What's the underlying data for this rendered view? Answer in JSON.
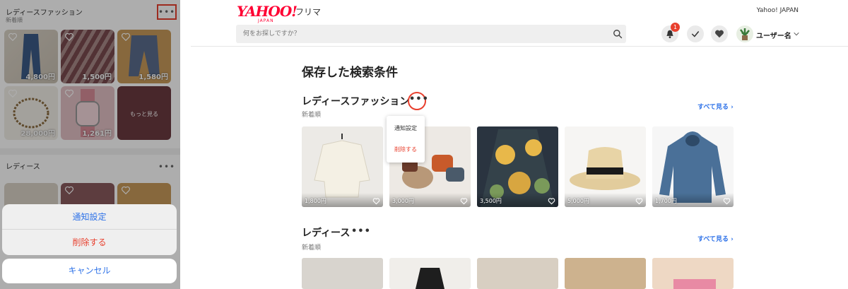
{
  "mobile": {
    "section1": {
      "title": "レディースファッション",
      "sort": "新着順",
      "more": "•••"
    },
    "items": [
      {
        "price": "4,800円"
      },
      {
        "price": "1,500円"
      },
      {
        "price": "1,580円"
      },
      {
        "price": "28,000円"
      },
      {
        "price": "1,261円"
      },
      {
        "price": "",
        "more_label": "もっと見る"
      }
    ],
    "section2": {
      "title": "レディース",
      "more": "•••"
    },
    "sheet": {
      "notify": "通知設定",
      "delete": "削除する",
      "cancel": "キャンセル"
    }
  },
  "header": {
    "logo": "YAHOO!",
    "logo_sub": "JAPAN",
    "app_name": "フリマ",
    "yj_link": "Yahoo! JAPAN",
    "search_placeholder": "何をお探しですか？",
    "notification_count": "1",
    "username": "ユーザー名"
  },
  "page": {
    "title": "保存した検索条件",
    "sections": [
      {
        "title": "レディースファッション",
        "sort": "新着順",
        "see_all": "すべて見る ›",
        "more": "•••",
        "items": [
          {
            "price": "1,800円"
          },
          {
            "price": "3,000円"
          },
          {
            "price": "3,500円"
          },
          {
            "price": "5,000円"
          },
          {
            "price": "1,700円"
          }
        ]
      },
      {
        "title": "レディース",
        "sort": "新着順",
        "see_all": "すべて見る ›",
        "more": "•••"
      }
    ],
    "popup": {
      "notify": "通知設定",
      "delete": "削除する"
    }
  },
  "colors": {
    "accent_red": "#e8402e",
    "link_blue": "#2e72e8",
    "brand_red": "#ff0033"
  }
}
